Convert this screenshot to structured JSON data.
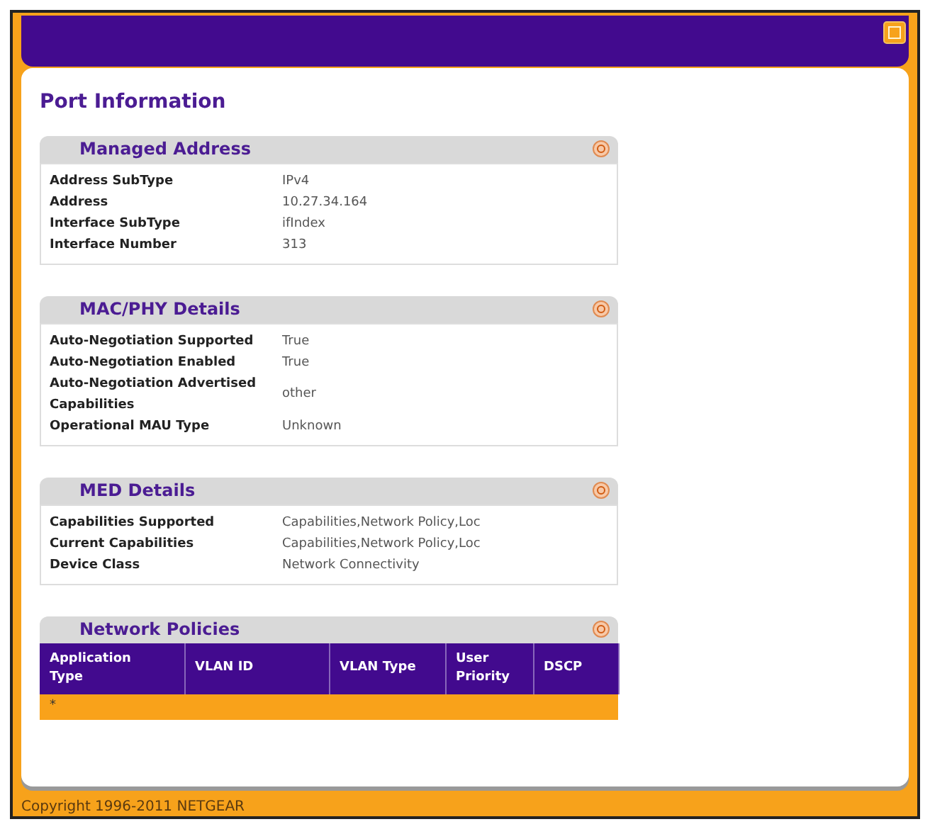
{
  "page_title": "Port Information",
  "sections": [
    {
      "kind": "fields",
      "title": "Managed Address",
      "rows": [
        {
          "label": "Address SubType",
          "value": "IPv4"
        },
        {
          "label": "Address",
          "value": "10.27.34.164"
        },
        {
          "label": "Interface SubType",
          "value": "ifIndex"
        },
        {
          "label": "Interface Number",
          "value": "313"
        }
      ]
    },
    {
      "kind": "fields",
      "title": "MAC/PHY Details",
      "rows": [
        {
          "label": "Auto-Negotiation Supported",
          "value": "True"
        },
        {
          "label": "Auto-Negotiation Enabled",
          "value": "True"
        },
        {
          "label": "Auto-Negotiation Advertised Capabilities",
          "value": "other"
        },
        {
          "label": "Operational MAU Type",
          "value": "Unknown"
        }
      ]
    },
    {
      "kind": "fields",
      "title": "MED Details",
      "rows": [
        {
          "label": "Capabilities Supported",
          "value": "Capabilities,Network Policy,Loc"
        },
        {
          "label": "Current Capabilities",
          "value": "Capabilities,Network Policy,Loc"
        },
        {
          "label": "Device Class",
          "value": "Network Connectivity"
        }
      ]
    },
    {
      "kind": "table",
      "title": "Network Policies",
      "columns": [
        "Application Type",
        "VLAN ID",
        "VLAN Type",
        "User Priority",
        "DSCP"
      ],
      "rows": [
        [
          "*",
          "",
          "",
          "",
          ""
        ]
      ]
    }
  ],
  "footer": "Copyright 1996-2011 NETGEAR"
}
